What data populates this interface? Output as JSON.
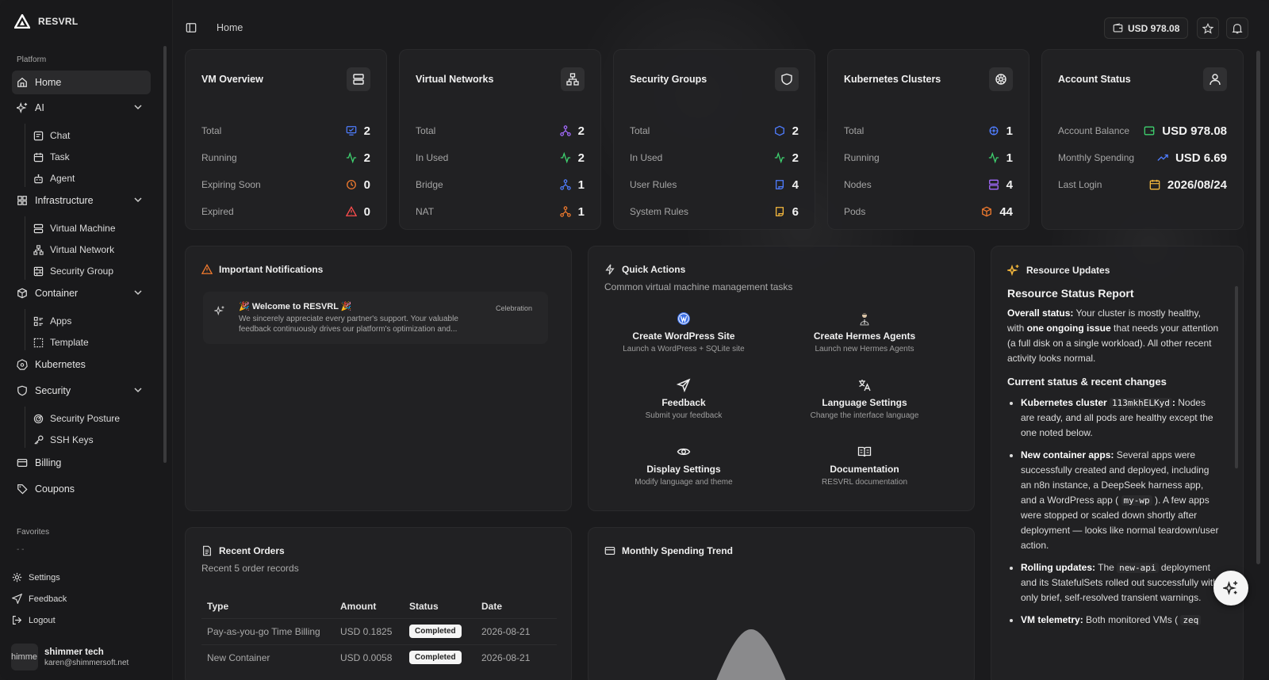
{
  "brand": {
    "name": "RESVRL"
  },
  "header": {
    "breadcrumb": "Home",
    "balance": "USD 978.08"
  },
  "sidebar": {
    "platform_label": "Platform",
    "favorites_label": "Favorites",
    "favorites_placeholder": "- -",
    "items": {
      "home": "Home",
      "ai": "AI",
      "chat": "Chat",
      "task": "Task",
      "agent": "Agent",
      "infrastructure": "Infrastructure",
      "virtual_machine": "Virtual Machine",
      "virtual_network": "Virtual Network",
      "security_group": "Security Group",
      "container": "Container",
      "apps": "Apps",
      "template": "Template",
      "kubernetes": "Kubernetes",
      "security": "Security",
      "security_posture": "Security Posture",
      "ssh_keys": "SSH Keys",
      "billing": "Billing",
      "coupons": "Coupons"
    },
    "footer": {
      "settings": "Settings",
      "feedback": "Feedback",
      "logout": "Logout"
    },
    "user": {
      "avatar_text": "himme",
      "name": "shimmer tech",
      "email": "karen@shimmersoft.net"
    }
  },
  "cards": {
    "vm": {
      "title": "VM Overview",
      "rows": [
        {
          "label": "Total",
          "value": "2"
        },
        {
          "label": "Running",
          "value": "2"
        },
        {
          "label": "Expiring Soon",
          "value": "0"
        },
        {
          "label": "Expired",
          "value": "0"
        }
      ]
    },
    "vnet": {
      "title": "Virtual Networks",
      "rows": [
        {
          "label": "Total",
          "value": "2"
        },
        {
          "label": "In Used",
          "value": "2"
        },
        {
          "label": "Bridge",
          "value": "1"
        },
        {
          "label": "NAT",
          "value": "1"
        }
      ]
    },
    "sg": {
      "title": "Security Groups",
      "rows": [
        {
          "label": "Total",
          "value": "2"
        },
        {
          "label": "In Used",
          "value": "2"
        },
        {
          "label": "User Rules",
          "value": "4"
        },
        {
          "label": "System Rules",
          "value": "6"
        }
      ]
    },
    "k8s": {
      "title": "Kubernetes Clusters",
      "rows": [
        {
          "label": "Total",
          "value": "1"
        },
        {
          "label": "Running",
          "value": "1"
        },
        {
          "label": "Nodes",
          "value": "4"
        },
        {
          "label": "Pods",
          "value": "44"
        }
      ]
    },
    "account": {
      "title": "Account Status",
      "rows": [
        {
          "label": "Account Balance",
          "value": "USD 978.08"
        },
        {
          "label": "Monthly Spending",
          "value": "USD 6.69"
        },
        {
          "label": "Last Login",
          "value": "2026/08/24"
        }
      ]
    }
  },
  "notifications": {
    "title": "Important Notifications",
    "item": {
      "title": "🎉 Welcome to RESVRL 🎉",
      "body": "We sincerely appreciate every partner's support. Your valuable feedback continuously drives our platform's optimization and...",
      "tag": "Celebration"
    }
  },
  "quick_actions": {
    "title": "Quick Actions",
    "subtitle": "Common virtual machine management tasks",
    "items": [
      {
        "title": "Create WordPress Site",
        "sub": "Launch a WordPress + SQLite site"
      },
      {
        "title": "Create Hermes Agents",
        "sub": "Launch new Hermes Agents"
      },
      {
        "title": "Feedback",
        "sub": "Submit your feedback"
      },
      {
        "title": "Language Settings",
        "sub": "Change the interface language"
      },
      {
        "title": "Display Settings",
        "sub": "Modify language and theme"
      },
      {
        "title": "Documentation",
        "sub": "RESVRL documentation"
      }
    ]
  },
  "orders": {
    "title": "Recent Orders",
    "subtitle": "Recent 5 order records",
    "columns": [
      "Type",
      "Amount",
      "Status",
      "Date"
    ],
    "rows": [
      {
        "type": "Pay-as-you-go Time Billing",
        "amount": "USD 0.1825",
        "status": "Completed",
        "date": "2026-08-21"
      },
      {
        "type": "New Container",
        "amount": "USD 0.0058",
        "status": "Completed",
        "date": "2026-08-21"
      }
    ]
  },
  "spending": {
    "title": "Monthly Spending Trend"
  },
  "resource_updates": {
    "title": "Resource Updates",
    "heading": "Resource Status Report",
    "overall_label": "Overall status:",
    "overall_text_1": "Your cluster is mostly healthy, with",
    "overall_bold": "one ongoing issue",
    "overall_text_2": "that needs your attention (a full disk on a single workload). All other recent activity looks normal.",
    "subheading": "Current status & recent changes",
    "bullets": {
      "k8s_label": "Kubernetes cluster",
      "k8s_code": "113mkhELKyd",
      "k8s_colon": ":",
      "k8s_text": "Nodes are ready, and all pods are healthy except the one noted below.",
      "apps_label": "New container apps:",
      "apps_text_1": "Several apps were successfully created and deployed, including an n8n instance, a DeepSeek harness app, and a WordPress app (",
      "apps_code": "my-wp",
      "apps_text_2": "). A few apps were stopped or scaled down shortly after deployment — looks like normal teardown/user action.",
      "rolling_label": "Rolling updates:",
      "rolling_text_1": "The",
      "rolling_code": "new-api",
      "rolling_text_2": "deployment and its StatefulSets rolled out successfully with only brief, self-resolved transient warnings.",
      "vm_label": "VM telemetry:",
      "vm_text": "Both monitored VMs (",
      "vm_code": "zeq"
    }
  },
  "colors": {
    "accent_blue": "#4f7dff",
    "green": "#3ecf6e",
    "orange": "#f07a2e",
    "red": "#ff4d4d",
    "purple": "#a46bff",
    "yellow": "#f5b83d"
  }
}
